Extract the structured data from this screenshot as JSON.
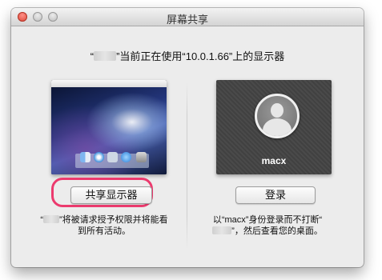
{
  "window": {
    "title": "屏幕共享"
  },
  "message": {
    "prefix": "“",
    "suffix": "”当前正在使用“10.0.1.66”上的显示器"
  },
  "local_screen": {
    "description_before": "“",
    "description_after": "”将被请求授予权限并将能看到所有活动。"
  },
  "remote": {
    "user_name": "macx",
    "description_before": "以“macx”身份登录而不打断“",
    "description_after": "”，然后查看您的桌面。"
  },
  "buttons": {
    "share_label": "共享显示器",
    "login_label": "登录"
  },
  "colors": {
    "highlight": "#ec3a6e"
  }
}
